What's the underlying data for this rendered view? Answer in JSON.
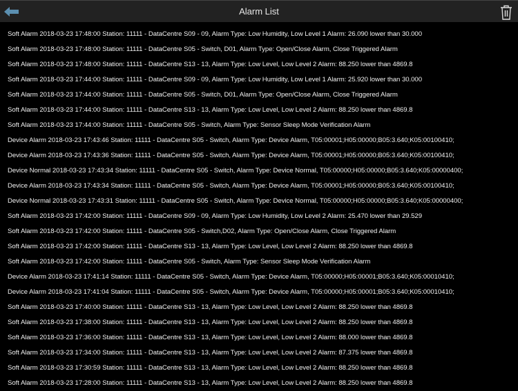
{
  "header": {
    "title": "Alarm List",
    "back_icon": "back-arrow-icon",
    "delete_icon": "trash-icon",
    "accent": "#5b8fb0"
  },
  "alarms": [
    "Soft Alarm 2018-03-23 17:48:00 Station: 11111 - DataCentre S09 - 09, Alarm Type: Low Humidity, Low Level 1 Alarm: 26.090 lower than 30.000",
    "Soft Alarm 2018-03-23 17:48:00 Station: 11111 - DataCentre S05 - Switch, D01, Alarm Type: Open/Close Alarm, Close Triggered Alarm",
    "Soft Alarm 2018-03-23 17:48:00 Station: 11111 - DataCentre S13 - 13, Alarm Type: Low Level, Low Level 2 Alarm: 88.250 lower than 4869.8",
    "Soft Alarm 2018-03-23 17:44:00 Station: 11111 - DataCentre S09 - 09, Alarm Type: Low Humidity, Low Level 1 Alarm: 25.920 lower than 30.000",
    "Soft Alarm 2018-03-23 17:44:00 Station: 11111 - DataCentre S05 - Switch, D01, Alarm Type: Open/Close Alarm, Close Triggered Alarm",
    "Soft Alarm 2018-03-23 17:44:00 Station: 11111 - DataCentre S13 - 13, Alarm Type: Low Level, Low Level 2 Alarm: 88.250 lower than 4869.8",
    "Soft Alarm 2018-03-23 17:44:00 Station: 11111 - DataCentre S05 - Switch, Alarm Type: Sensor Sleep Mode Verification Alarm",
    "Device Alarm 2018-03-23 17:43:46 Station: 11111 - DataCentre S05 - Switch, Alarm Type: Device Alarm, T05:00001;H05:00000;B05:3.640;K05:00100410;",
    "Device Alarm 2018-03-23 17:43:36 Station: 11111 - DataCentre S05 - Switch, Alarm Type: Device Alarm, T05:00001;H05:00000;B05:3.640;K05:00100410;",
    "Device Normal 2018-03-23 17:43:34 Station: 11111 - DataCentre S05 - Switch, Alarm Type: Device Normal, T05:00000;H05:00000;B05:3.640;K05:00000400;",
    "Device Alarm 2018-03-23 17:43:34 Station: 11111 - DataCentre S05 - Switch, Alarm Type: Device Alarm, T05:00001;H05:00000;B05:3.640;K05:00100410;",
    "Device Normal 2018-03-23 17:43:31 Station: 11111 - DataCentre S05 - Switch, Alarm Type: Device Normal, T05:00000;H05:00000;B05:3.640;K05:00000400;",
    "Soft Alarm 2018-03-23 17:42:00 Station: 11111 - DataCentre S09 - 09, Alarm Type: Low Humidity, Low Level 2 Alarm: 25.470 lower than 29.529",
    "Soft Alarm 2018-03-23 17:42:00 Station: 11111 - DataCentre S05 - Switch,D02, Alarm Type: Open/Close Alarm, Close Triggered Alarm",
    "Soft Alarm 2018-03-23 17:42:00 Station: 11111 - DataCentre S13 - 13, Alarm Type: Low Level, Low Level 2 Alarm: 88.250 lower than 4869.8",
    "Soft Alarm 2018-03-23 17:42:00 Station: 11111 - DataCentre S05 - Switch, Alarm Type: Sensor Sleep Mode Verification Alarm",
    "Device Alarm 2018-03-23 17:41:14 Station: 11111 - DataCentre S05 - Switch, Alarm Type: Device Alarm, T05:00000;H05:00001;B05:3.640;K05:00010410;",
    "Device Alarm 2018-03-23 17:41:04 Station: 11111 - DataCentre S05 - Switch, Alarm Type: Device Alarm, T05:00000;H05:00001;B05:3.640;K05:00010410;",
    "Soft Alarm 2018-03-23 17:40:00 Station: 11111 - DataCentre S13 - 13, Alarm Type: Low Level, Low Level 2 Alarm: 88.250 lower than 4869.8",
    "Soft Alarm 2018-03-23 17:38:00 Station: 11111 - DataCentre S13 - 13, Alarm Type: Low Level, Low Level 2 Alarm: 88.250 lower than 4869.8",
    "Soft Alarm 2018-03-23 17:36:00 Station: 11111 - DataCentre S13 - 13, Alarm Type: Low Level, Low Level 2 Alarm: 88.000 lower than 4869.8",
    "Soft Alarm 2018-03-23 17:34:00 Station: 11111 - DataCentre S13 - 13, Alarm Type: Low Level, Low Level 2 Alarm: 87.375 lower than 4869.8",
    "Soft Alarm 2018-03-23 17:30:59 Station: 11111 - DataCentre S13 - 13, Alarm Type: Low Level, Low Level 2 Alarm: 88.250 lower than 4869.8",
    "Soft Alarm 2018-03-23 17:28:00 Station: 11111 - DataCentre S13 - 13, Alarm Type: Low Level, Low Level 2 Alarm: 88.250 lower than 4869.8"
  ]
}
